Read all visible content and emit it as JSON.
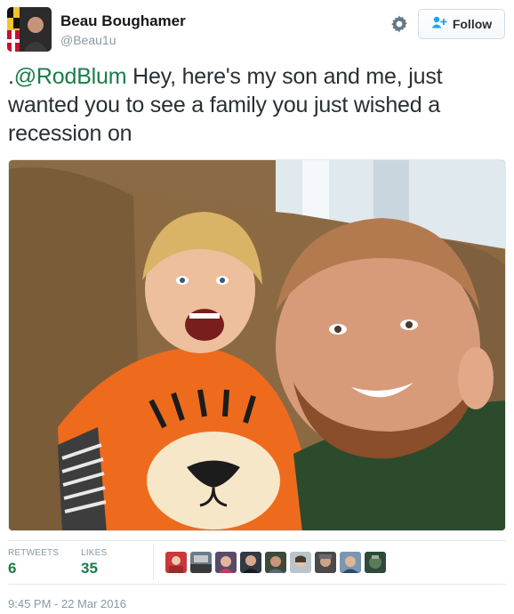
{
  "user": {
    "display_name": "Beau Boughamer",
    "handle": "@Beau1u"
  },
  "header": {
    "follow_label": "Follow",
    "accent_color": "#1da1f2"
  },
  "tweet": {
    "prefix": ".",
    "mention": "@RodBlum",
    "body": " Hey, here's my son and me, just wanted you to see a family you just wished a recession on",
    "mention_color": "#1a7c4b"
  },
  "stats": {
    "retweets_label": "RETWEETS",
    "retweets_value": "6",
    "likes_label": "LIKES",
    "likes_value": "35"
  },
  "likers_count_shown": 9,
  "footer": {
    "timestamp": "9:45 PM - 22 Mar 2016"
  }
}
